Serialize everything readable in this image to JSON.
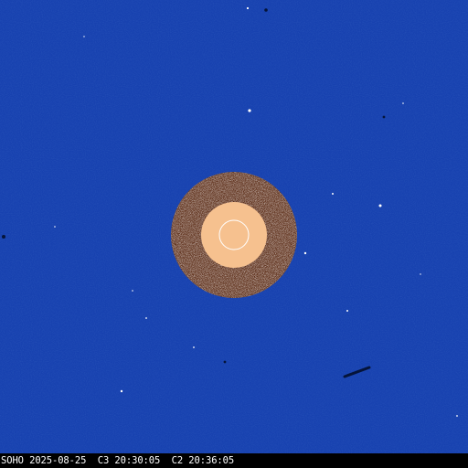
{
  "image": {
    "caption": "SOHO 2025-08-25  C3 20:30:05  C2 20:36:05",
    "colors": {
      "sky": "#1842b0",
      "occulter_inner": "#f6c18f",
      "occulter_ring_dark": "#5a2a14",
      "occulter_ring_light": "#ffffff",
      "sun_outline": "#ffffff",
      "caption_bar": "#000000",
      "caption_text": "#ffffff"
    }
  }
}
